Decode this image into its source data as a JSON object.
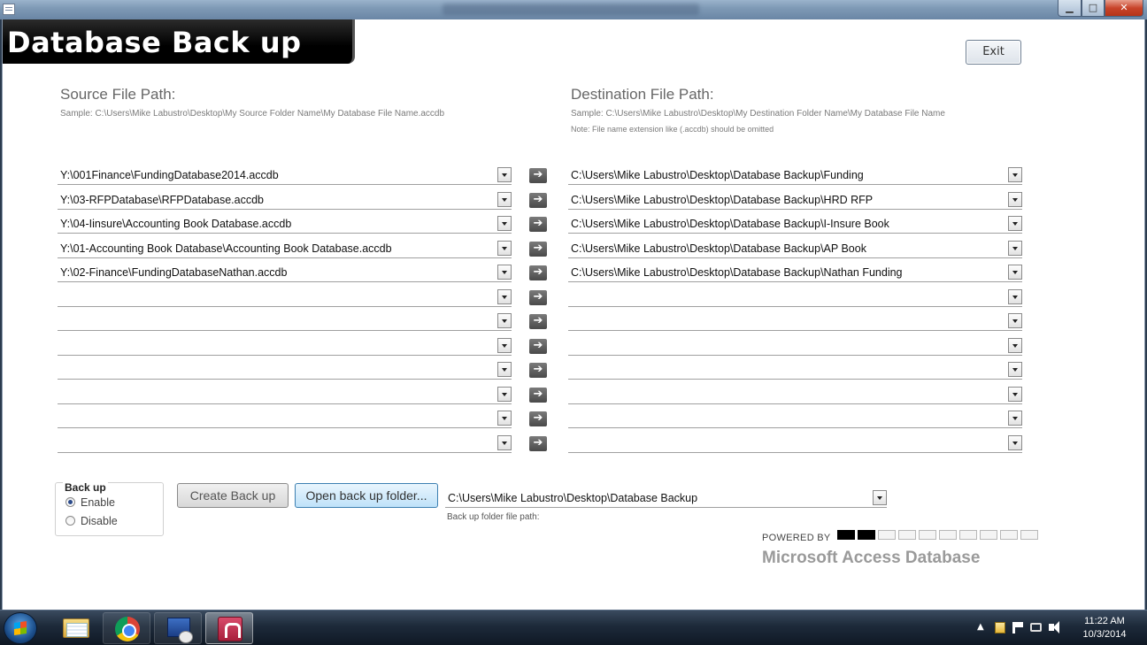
{
  "window": {
    "minimize_glyph": "▁",
    "maximize_glyph": "□",
    "close_glyph": "✕"
  },
  "form": {
    "title": "Database Back up",
    "exit_label": "Exit",
    "source": {
      "heading": "Source File Path:",
      "sample": "Sample: C:\\Users\\Mike Labustro\\Desktop\\My Source Folder Name\\My Database File Name.accdb"
    },
    "destination": {
      "heading": "Destination File Path:",
      "sample": "Sample: C:\\Users\\Mike Labustro\\Desktop\\My Destination Folder Name\\My Database File Name",
      "note": "Note: File name extension like (.accdb) should be omitted"
    },
    "arrow_glyph": "➔",
    "rows": [
      {
        "source": "Y:\\001Finance\\FundingDatabase2014.accdb",
        "destination": "C:\\Users\\Mike Labustro\\Desktop\\Database Backup\\Funding"
      },
      {
        "source": "Y:\\03-RFPDatabase\\RFPDatabase.accdb",
        "destination": "C:\\Users\\Mike Labustro\\Desktop\\Database Backup\\HRD RFP"
      },
      {
        "source": "Y:\\04-Iinsure\\Accounting Book Database.accdb",
        "destination": "C:\\Users\\Mike Labustro\\Desktop\\Database Backup\\I-Insure Book"
      },
      {
        "source": "Y:\\01-Accounting Book Database\\Accounting Book Database.accdb",
        "destination": "C:\\Users\\Mike Labustro\\Desktop\\Database Backup\\AP Book"
      },
      {
        "source": "Y:\\02-Finance\\FundingDatabaseNathan.accdb",
        "destination": "C:\\Users\\Mike Labustro\\Desktop\\Database Backup\\Nathan Funding"
      },
      {
        "source": "",
        "destination": ""
      },
      {
        "source": "",
        "destination": ""
      },
      {
        "source": "",
        "destination": ""
      },
      {
        "source": "",
        "destination": ""
      },
      {
        "source": "",
        "destination": ""
      },
      {
        "source": "",
        "destination": ""
      },
      {
        "source": "",
        "destination": ""
      }
    ],
    "backup_group": {
      "legend": "Back up",
      "options": [
        "Enable",
        "Disable"
      ],
      "selected": "Enable"
    },
    "create_backup_label": "Create Back up",
    "open_folder_label": "Open back up folder...",
    "backup_folder_value": "C:\\Users\\Mike Labustro\\Desktop\\Database Backup",
    "backup_folder_label": "Back up folder file path:",
    "powered_by": "POWERED BY",
    "power_level": 0.2,
    "product": "Microsoft Access Database"
  },
  "taskbar": {
    "apps": [
      "windows-explorer",
      "google-chrome",
      "remote-desktop",
      "microsoft-access"
    ],
    "active_app": "microsoft-access",
    "tray_chevron": "▲",
    "time": "11:22 AM",
    "date": "10/3/2014"
  }
}
